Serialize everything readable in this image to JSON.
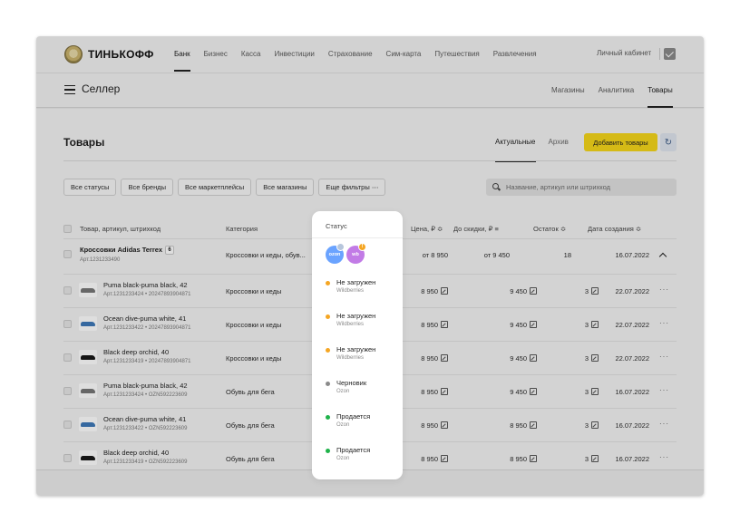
{
  "header": {
    "brand": "ТИНЬКОФФ",
    "nav": [
      "Банк",
      "Бизнес",
      "Касса",
      "Инвестиции",
      "Страхование",
      "Сим-карта",
      "Путешествия",
      "Развлечения"
    ],
    "active_nav": "Банк",
    "account_label": "Личный кабинет"
  },
  "subheader": {
    "title": "Селлер",
    "nav": [
      "Магазины",
      "Аналитика",
      "Товары"
    ],
    "active_nav": "Товары"
  },
  "page": {
    "title": "Товары",
    "tabs": [
      "Актуальные",
      "Архив"
    ],
    "active_tab": "Актуальные",
    "add_button": "Добавить товары",
    "refresh_icon": "refresh-icon"
  },
  "filters": {
    "chips": [
      "Все статусы",
      "Все бренды",
      "Все маркетплейсы",
      "Все магазины",
      "Еще фильтры ⋯"
    ],
    "search_placeholder": "Название, артикул или штрихкод"
  },
  "table": {
    "columns": {
      "product": "Товар, артикул, штрихкод",
      "category": "Категория",
      "status": "Статус",
      "price": "Цена, ₽ ≎",
      "discount_price": "До скидки, ₽ ≡",
      "stock": "Остаток ≎",
      "created": "Дата создания ≎"
    },
    "group": {
      "name": "Кроссовки Adidas Terrex",
      "count": "6",
      "article": "Арт.1231233490",
      "category": "Кроссовки и кеды, обув...",
      "marketplaces": [
        "ozon",
        "wb"
      ],
      "wb_alert": "!",
      "price": "от 8 950",
      "discount_price": "от 9 450",
      "stock": "18",
      "created": "16.07.2022"
    },
    "rows": [
      {
        "name": "Puma black-puma black, 42",
        "sub": "Арт.1231233424 • 20247893904871",
        "category": "Кроссовки и кеды",
        "status": "Не загружен",
        "marketplace": "Wildberries",
        "price": "8 950",
        "discount_price": "9 450",
        "stock": "3",
        "created": "22.07.2022",
        "status_color": "#f5a623",
        "shoe_color": "#777777"
      },
      {
        "name": "Ocean dive-puma white, 41",
        "sub": "Арт.1231233422 • 20247893904871",
        "category": "Кроссовки и кеды",
        "status": "Не загружен",
        "marketplace": "Wildberries",
        "price": "8 950",
        "discount_price": "9 450",
        "stock": "3",
        "created": "22.07.2022",
        "status_color": "#f5a623",
        "shoe_color": "#3f79b8"
      },
      {
        "name": "Black deep orchid, 40",
        "sub": "Арт.1231233419 • 20247893904871",
        "category": "Кроссовки и кеды",
        "status": "Не загружен",
        "marketplace": "Wildberries",
        "price": "8 950",
        "discount_price": "9 450",
        "stock": "3",
        "created": "22.07.2022",
        "status_color": "#f5a623",
        "shoe_color": "#1a1a1a"
      },
      {
        "name": "Puma black-puma black, 42",
        "sub": "Арт.1231233424 • OZN592223609",
        "category": "Обувь для бега",
        "status": "Черновик",
        "marketplace": "Ozon",
        "price": "8 950",
        "discount_price": "9 450",
        "stock": "3",
        "created": "16.07.2022",
        "status_color": "#8a8a8a",
        "shoe_color": "#777777"
      },
      {
        "name": "Ocean dive-puma white, 41",
        "sub": "Арт.1231233422 • OZN592223609",
        "category": "Обувь для бега",
        "status": "Продается",
        "marketplace": "Ozon",
        "price": "8 950",
        "discount_price": "8 950",
        "stock": "3",
        "created": "16.07.2022",
        "status_color": "#1fb24a",
        "shoe_color": "#3f79b8"
      },
      {
        "name": "Black deep orchid, 40",
        "sub": "Арт.1231233419 • OZN592223609",
        "category": "Обувь для бега",
        "status": "Продается",
        "marketplace": "Ozon",
        "price": "8 950",
        "discount_price": "8 950",
        "stock": "3",
        "created": "16.07.2022",
        "status_color": "#1fb24a",
        "shoe_color": "#1a1a1a"
      }
    ]
  }
}
